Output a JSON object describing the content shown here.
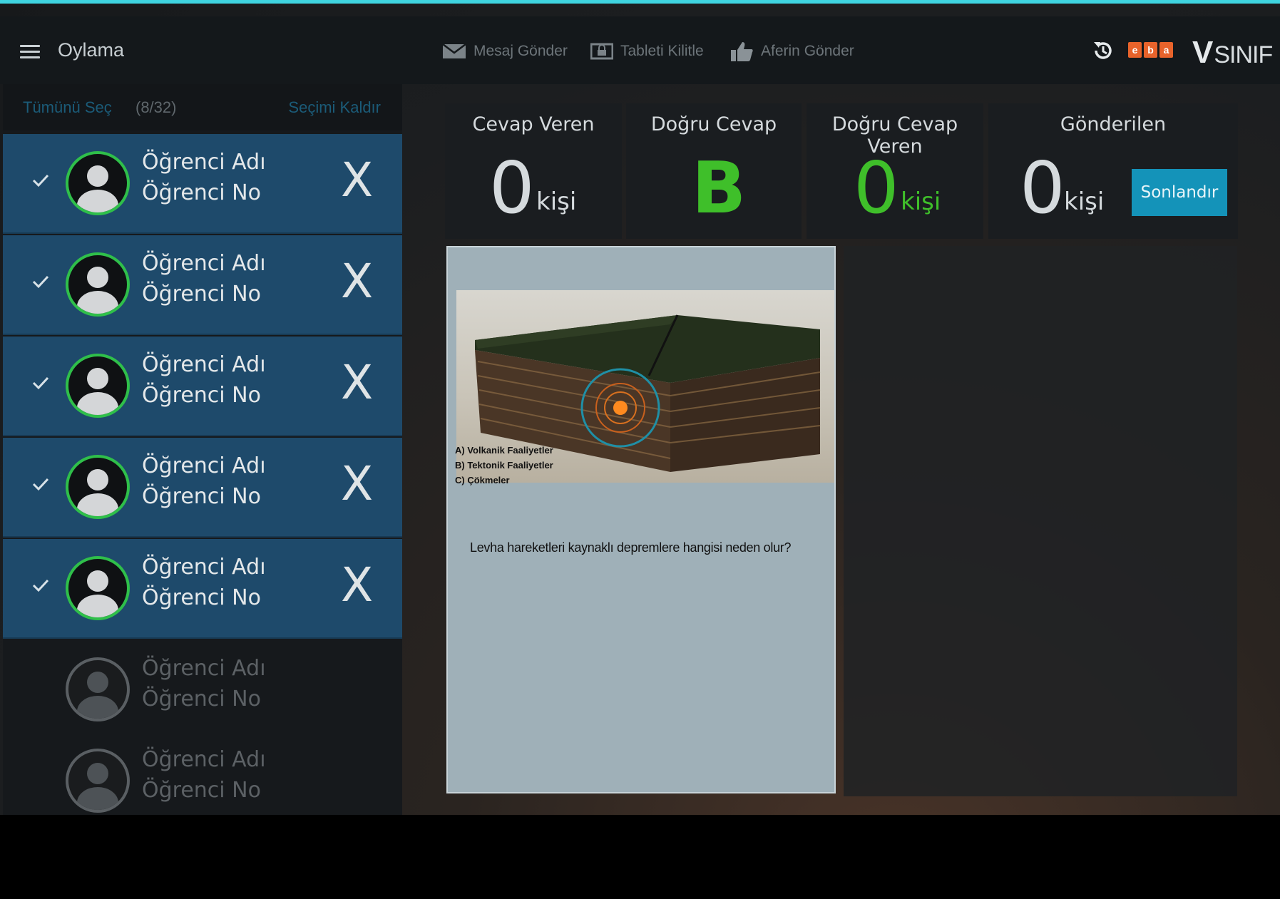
{
  "header": {
    "title": "Oylama",
    "tools": [
      {
        "label": "Mesaj Gönder",
        "icon": "envelope-icon"
      },
      {
        "label": "Tableti Kilitle",
        "icon": "lock-tablet-icon"
      },
      {
        "label": "Aferin Gönder",
        "icon": "thumbs-up-icon"
      }
    ],
    "logo_text": "SINIF",
    "logo_prefix": "V",
    "eba_letters": [
      "e",
      "b",
      "a"
    ]
  },
  "sidebar": {
    "select_all": "Tümünü Seç",
    "count": "(8/32)",
    "clear": "Seçimi Kaldır",
    "students": [
      {
        "name": "Öğrenci Adı",
        "no": "Öğrenci No",
        "selected": true,
        "remove": "X"
      },
      {
        "name": "Öğrenci Adı",
        "no": "Öğrenci No",
        "selected": true,
        "remove": "X"
      },
      {
        "name": "Öğrenci Adı",
        "no": "Öğrenci No",
        "selected": true,
        "remove": "X"
      },
      {
        "name": "Öğrenci Adı",
        "no": "Öğrenci No",
        "selected": true,
        "remove": "X"
      },
      {
        "name": "Öğrenci Adı",
        "no": "Öğrenci No",
        "selected": true,
        "remove": "X"
      },
      {
        "name": "Öğrenci Adı",
        "no": "Öğrenci No",
        "selected": false,
        "remove": ""
      },
      {
        "name": "Öğrenci Adı",
        "no": "Öğrenci No",
        "selected": false,
        "remove": ""
      }
    ]
  },
  "stats": {
    "answered_label": "Cevap Veren",
    "answered_value": "0",
    "answered_unit": "kişi",
    "correct_label": "Doğru Cevap",
    "correct_value": "B",
    "correct_answered_label": "Doğru Cevap Veren",
    "correct_answered_value": "0",
    "correct_answered_unit": "kişi",
    "sent_label": "Gönderilen",
    "sent_value": "0",
    "sent_unit": "kişi",
    "finish_button": "Sonlandır"
  },
  "question": {
    "options": [
      "A) Volkanik Faaliyetler",
      "B) Tektonik Faaliyetler",
      "C) Çökmeler"
    ],
    "text": "Levha hareketleri kaynaklı depremlere hangisi neden olur?"
  },
  "colors": {
    "accent": "#1493b9",
    "selected_row": "#1e4a6b",
    "correct_green": "#3fbf2a",
    "avatar_ring": "#2fbf4a"
  }
}
